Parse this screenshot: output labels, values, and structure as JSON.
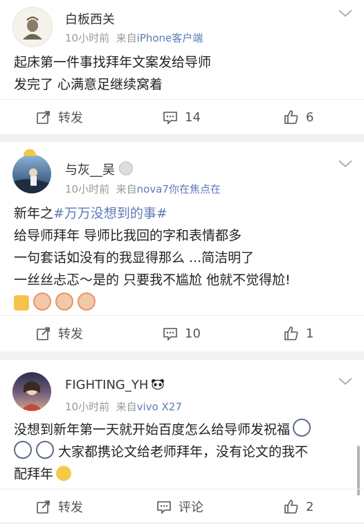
{
  "posts": [
    {
      "user": "白板西关",
      "time": "10小时前",
      "from": "来自",
      "source": "iPhone客户端",
      "lines": [
        "起床第一件事找拜年文案发给导师",
        "发完了 心满意足继续窝着"
      ],
      "actions": {
        "repost": "转发",
        "comment": "14",
        "like": "6"
      }
    },
    {
      "user": "与灰__吴",
      "time": "10小时前",
      "from": "来自",
      "source": "nova7你在焦点在",
      "line1_prefix": "新年之",
      "topic": "#万万没想到的事#",
      "lines": [
        "给导师拜年 导师比我回的字和表情都多",
        "一句套话如没有的我显得那么 ...简洁明了",
        "一丝丝忐忑～是的 只要我不尴尬 他就不觉得尬!"
      ],
      "actions": {
        "repost": "转发",
        "comment": "10",
        "like": "1"
      }
    },
    {
      "user": "FIGHTING_YH",
      "time": "10小时前",
      "from": "来自",
      "source": "vivo X27",
      "lines": [
        "没想到新年第一天就开始百度怎么给导师发祝福",
        "大家都携论文给老师拜年，没有论文的我不",
        "配拜年"
      ],
      "actions": {
        "repost": "转发",
        "comment": "评论",
        "like": "2"
      }
    }
  ]
}
